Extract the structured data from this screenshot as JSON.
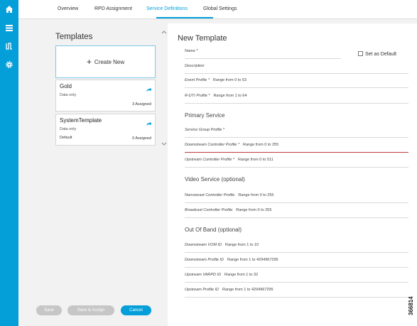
{
  "nav": {
    "tabs": [
      {
        "label": "Overview"
      },
      {
        "label": "RPD Assignment"
      },
      {
        "label": "Service Definitions",
        "active": true
      },
      {
        "label": "Global Settings"
      }
    ]
  },
  "rail": {
    "icons": [
      "home-icon",
      "list-icon",
      "waveform-icon",
      "gear-icon"
    ],
    "color": "#049fd9"
  },
  "templates": {
    "heading": "Templates",
    "create_label": "Create New",
    "items": [
      {
        "name": "Gold",
        "subtitle": "Data only",
        "tag": "",
        "assigned": "3 Assigned"
      },
      {
        "name": "SystemTemplate",
        "subtitle": "Data only",
        "tag": "Default",
        "assigned": "0 Assigned"
      }
    ]
  },
  "form": {
    "title": "New Template",
    "set_default_label": "Set as Default",
    "fields": {
      "name": {
        "label": "Name *",
        "range": ""
      },
      "description": {
        "label": "Description",
        "range": ""
      },
      "event_profile": {
        "label": "Event Profile *",
        "range": "Range from 0 to 63"
      },
      "rdti_profile": {
        "label": "R-DTI Profile *",
        "range": "Range from 1 to 64"
      },
      "service_group_profile": {
        "label": "Service Group Profile *",
        "range": ""
      },
      "downstream_controller_profile": {
        "label": "Downstream Controller Profile *",
        "range": "Range from 0 to 255"
      },
      "upstream_controller_profile": {
        "label": "Upstream Controller Profile *",
        "range": "Range from 0 to 511"
      },
      "narrowcast_controller_profile": {
        "label": "Narrowcast Controller Profile",
        "range": "Range from 0 to 255"
      },
      "broadcast_controller_profile": {
        "label": "Broadcast Controller Profile",
        "range": "Range from 0 to 255"
      },
      "downstream_vom_id": {
        "label": "Downstream VOM ID",
        "range": "Range from 1 to 10"
      },
      "downstream_profile_id": {
        "label": "Downstream Profile ID",
        "range": "Range from 1 to 4294967295"
      },
      "upstream_varpd_id": {
        "label": "Upstream VARPD ID",
        "range": "Range from 1 to 32"
      },
      "upstream_profile_id": {
        "label": "Upstream Profile ID",
        "range": "Range from 1 to 4294967295"
      }
    },
    "sections": {
      "primary": "Primary Service",
      "video": "Video Service (optional)",
      "oob": "Out Of Band (optional)"
    },
    "buttons": {
      "save": "Save",
      "save_assign": "Save & Assign",
      "cancel": "Cancel"
    }
  },
  "figure_id": "366814",
  "colors": {
    "accent": "#049fd9",
    "error_underline": "#c03a3a",
    "disabled_button": "#c6c6c6"
  }
}
